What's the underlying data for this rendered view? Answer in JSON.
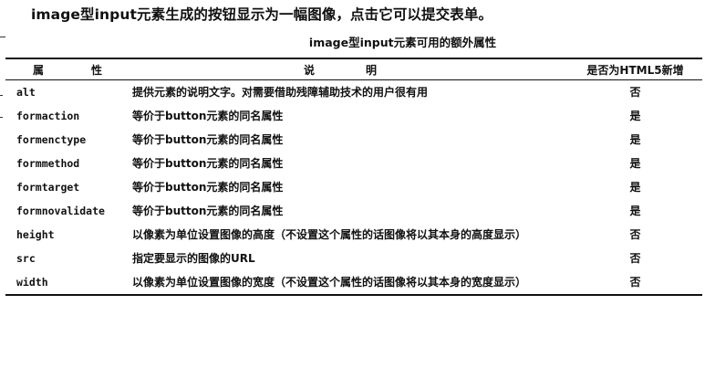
{
  "intro": "image型input元素生成的按钮显示为一幅图像，点击它可以提交表单。",
  "table": {
    "caption": "image型input元素可用的额外属性",
    "headers": [
      "属　性",
      "说　明",
      "是否为HTML5新增"
    ],
    "rows": [
      {
        "attr": "alt",
        "desc": "提供元素的说明文字。对需要借助残障辅助技术的用户很有用",
        "new": "否"
      },
      {
        "attr": "formaction",
        "desc": "等价于button元素的同名属性",
        "new": "是"
      },
      {
        "attr": "formenctype",
        "desc": "等价于button元素的同名属性",
        "new": "是"
      },
      {
        "attr": "formmethod",
        "desc": "等价于button元素的同名属性",
        "new": "是"
      },
      {
        "attr": "formtarget",
        "desc": "等价于button元素的同名属性",
        "new": "是"
      },
      {
        "attr": "formnovalidate",
        "desc": "等价于button元素的同名属性",
        "new": "是"
      },
      {
        "attr": "height",
        "desc": "以像素为单位设置图像的高度（不设置这个属性的话图像将以其本身的高度显示）",
        "new": "否"
      },
      {
        "attr": "src",
        "desc": "指定要显示的图像的URL",
        "new": "否"
      },
      {
        "attr": "width",
        "desc": "以像素为单位设置图像的宽度（不设置这个属性的话图像将以其本身的宽度显示）",
        "new": "否"
      }
    ]
  }
}
